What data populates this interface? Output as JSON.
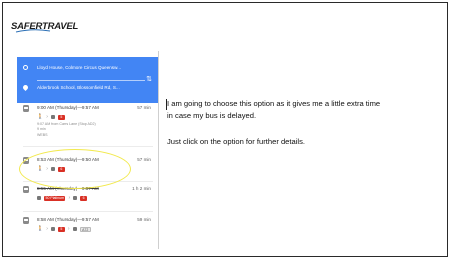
{
  "logo": {
    "text": "SAFERTRAVEL",
    "tagline": "safer travel"
  },
  "phone": {
    "origin": "Lloyd House, Colmore Circus Queensw...",
    "destination": "Alderbrook School, Blossomfield Rd, S...",
    "routes": [
      {
        "time": "9:00 AM (Thursday)—9:57 AM",
        "duration": "57 min",
        "badges": [
          "5"
        ],
        "sub1": "9:07 AM from Carrs Lane (Stop AD2)",
        "sub2": "9 min",
        "sub3": "WEBS"
      },
      {
        "time": "8:53 AM (Thursday)—9:50 AM",
        "duration": "57 min",
        "badges": [
          "6"
        ]
      },
      {
        "time": "8:55 AM (Thursday)—9:57 AM",
        "duration": "1 h 2 min",
        "badges": [
          "50 Platinum",
          "6"
        ]
      },
      {
        "time": "8:58 AM (Thursday)—9:57 AM",
        "duration": "59 min",
        "badges": [
          "5",
          "A72"
        ]
      }
    ]
  },
  "note": {
    "line1": "I am going to choose this option as it gives me a little extra time",
    "line2": "in case my bus is delayed.",
    "line3": "Just click on the option for further details."
  },
  "colors": {
    "map_blue": "#4285f4",
    "highlight": "#f2e94e",
    "badge_red": "#d93025"
  }
}
